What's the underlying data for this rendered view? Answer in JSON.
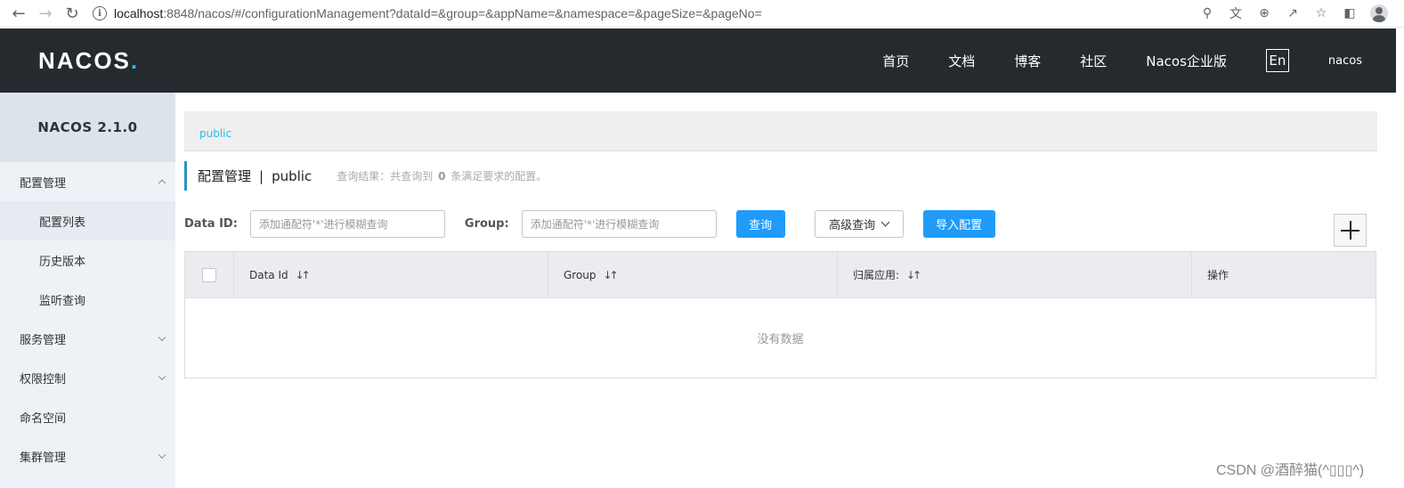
{
  "browser": {
    "url_host": "localhost",
    "url_rest": ":8848/nacos/#/configurationManagement?dataId=&group=&appName=&namespace=&pageSize=&pageNo="
  },
  "header": {
    "logo": "NACOS",
    "logo_dot": ".",
    "nav": [
      "首页",
      "文档",
      "博客",
      "社区",
      "Nacos企业版"
    ],
    "lang": "En",
    "user": "nacos"
  },
  "sidebar": {
    "title": "NACOS 2.1.0",
    "items": [
      {
        "label": "配置管理"
      },
      {
        "label": "配置列表"
      },
      {
        "label": "历史版本"
      },
      {
        "label": "监听查询"
      },
      {
        "label": "服务管理"
      },
      {
        "label": "权限控制"
      },
      {
        "label": "命名空间"
      },
      {
        "label": "集群管理"
      }
    ]
  },
  "main": {
    "namespace_tab": "public",
    "page_title": "配置管理",
    "separator": "|",
    "namespace": "public",
    "query_result_prefix": "查询结果：共查询到",
    "query_count": "0",
    "query_result_suffix": "条满足要求的配置。",
    "data_id_label": "Data ID:",
    "data_id_placeholder": "添加通配符'*'进行模糊查询",
    "group_label": "Group:",
    "group_placeholder": "添加通配符'*'进行模糊查询",
    "query_button": "查询",
    "advanced_query": "高级查询",
    "import_button": "导入配置",
    "table": {
      "columns": [
        "Data Id",
        "Group",
        "归属应用:",
        "操作"
      ],
      "empty_text": "没有数据"
    }
  },
  "watermark": "CSDN @酒醉猫(^▯▯▯^)"
}
